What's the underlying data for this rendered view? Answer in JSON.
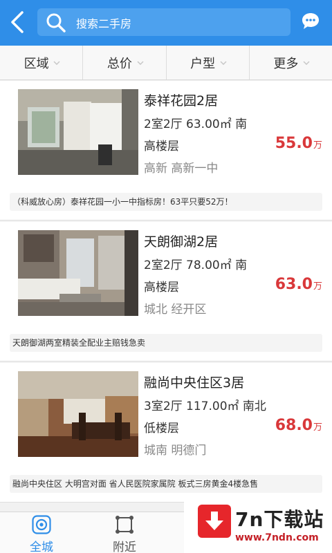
{
  "header": {
    "back_icon": "back-chevron-icon",
    "search_placeholder": "搜索二手房",
    "search_icon": "search-icon",
    "chat_icon": "chat-bubble-icon",
    "bar_color": "#2f8ee8"
  },
  "filters": [
    {
      "label": "区域"
    },
    {
      "label": "总价"
    },
    {
      "label": "户型"
    },
    {
      "label": "更多"
    }
  ],
  "listings": [
    {
      "title": "泰祥花园2居",
      "layout": "2室2厅 63.00㎡ 南",
      "floor": "高楼层",
      "location": "高新 高新一中",
      "price": "55.0",
      "unit": "万",
      "desc": "（科威放心房）泰祥花园一小一中指标房！63平只要52万！"
    },
    {
      "title": "天朗御湖2居",
      "layout": "2室2厅 78.00㎡ 南",
      "floor": "高楼层",
      "location": "城北 经开区",
      "price": "63.0",
      "unit": "万",
      "desc": "天朗御湖两室精装全配业主赔钱急卖"
    },
    {
      "title": "融尚中央住区3居",
      "layout": "3室2厅 117.00㎡ 南北",
      "floor": "低楼层",
      "location": "城南 明德门",
      "price": "68.0",
      "unit": "万",
      "desc": "融尚中央住区 大明宫对面 省人民医院家属院 板式三房黄金4楼急售"
    }
  ],
  "tabbar": [
    {
      "label": "全城",
      "icon": "target-icon",
      "active": true
    },
    {
      "label": "附近",
      "icon": "nearby-frame-icon",
      "active": false
    }
  ],
  "watermark": {
    "title": "7n下载站",
    "url": "www.7ndn.com",
    "logo_icon": "download-arrow-icon"
  },
  "colors": {
    "accent": "#2f8ee8",
    "price": "#d9383a"
  }
}
